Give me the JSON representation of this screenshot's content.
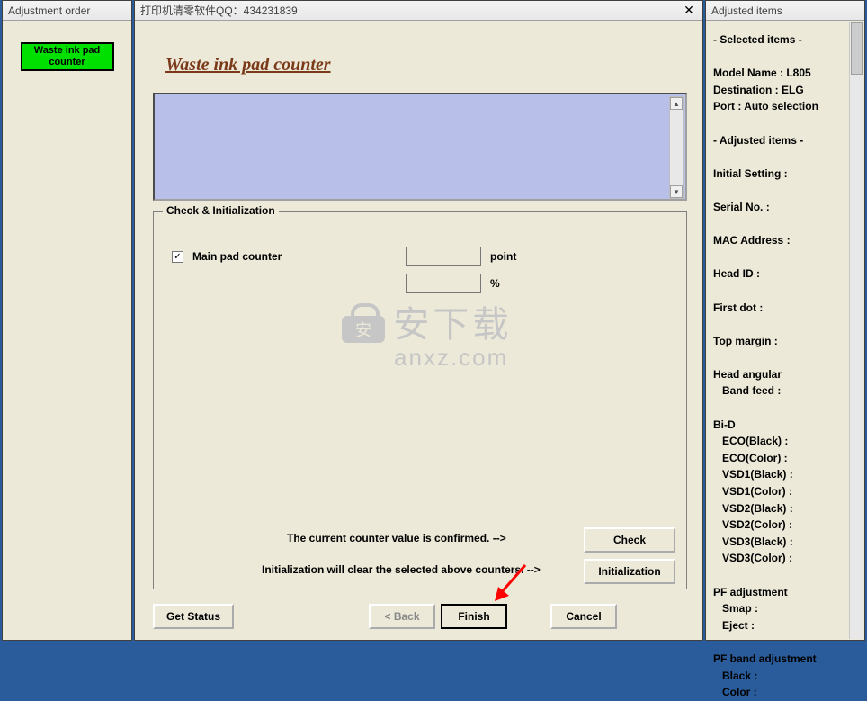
{
  "left": {
    "title": "Adjustment order",
    "button_label": "Waste ink pad counter"
  },
  "center": {
    "title": "打印机清零软件QQ：434231839",
    "heading": "Waste ink pad counter",
    "group": {
      "legend": "Check & Initialization",
      "main_pad_label": "Main pad counter",
      "main_pad_checked": "✓",
      "unit_point": "point",
      "unit_percent": "%",
      "confirm_text": "The current counter value is confirmed. -->",
      "init_text": "Initialization will clear the selected above counters. -->",
      "check_label": "Check",
      "init_label": "Initialization"
    },
    "buttons": {
      "get_status": "Get Status",
      "back": "< Back",
      "finish": "Finish",
      "cancel": "Cancel"
    }
  },
  "right": {
    "title": "Adjusted items",
    "selected_header": "- Selected items -",
    "model_name": "Model Name : L805",
    "destination": "Destination : ELG",
    "port": "Port : Auto selection",
    "adjusted_header": "- Adjusted items -",
    "initial_setting": "Initial Setting :",
    "serial_no": "Serial No. :",
    "mac": "MAC Address :",
    "head_id": "Head ID :",
    "first_dot": "First dot :",
    "top_margin": "Top margin :",
    "head_angular": "Head angular",
    "band_feed": "Band feed :",
    "bi_d": "Bi-D",
    "eco_black": "ECO(Black)  :",
    "eco_color": "ECO(Color)  :",
    "vsd1_black": "VSD1(Black) :",
    "vsd1_color": "VSD1(Color) :",
    "vsd2_black": "VSD2(Black) :",
    "vsd2_color": "VSD2(Color) :",
    "vsd3_black": "VSD3(Black) :",
    "vsd3_color": "VSD3(Color) :",
    "pf_adj": "PF adjustment",
    "smap": "Smap :",
    "eject": "Eject :",
    "pf_band": "PF band adjustment",
    "black": "Black :",
    "color": "Color :"
  },
  "watermark": {
    "text": "安下载",
    "url": "anxz.com"
  }
}
